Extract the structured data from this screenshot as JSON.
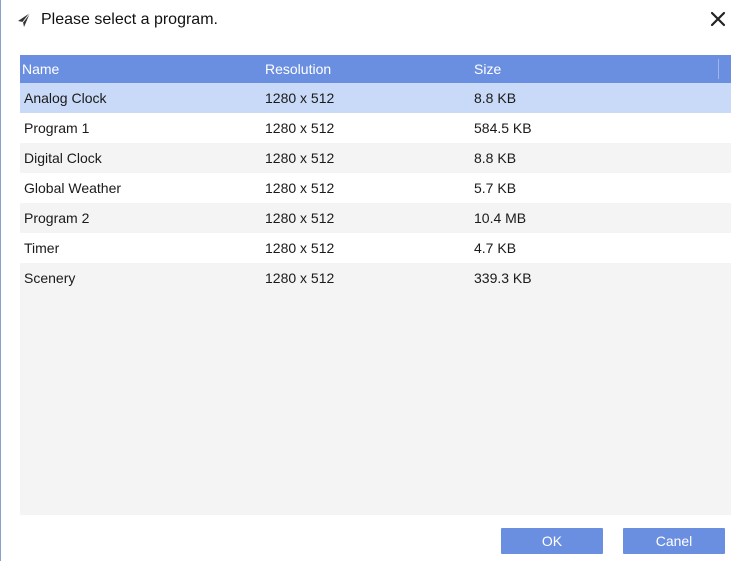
{
  "dialog": {
    "title": "Please select a program.",
    "title_icon": "send-arrow-icon",
    "close_icon": "close-icon"
  },
  "table": {
    "columns": {
      "name": "Name",
      "resolution": "Resolution",
      "size": "Size"
    },
    "selected_index": 0,
    "rows": [
      {
        "name": "Analog Clock",
        "resolution": "1280 x 512",
        "size": "8.8 KB"
      },
      {
        "name": "Program 1",
        "resolution": "1280 x 512",
        "size": "584.5 KB"
      },
      {
        "name": "Digital Clock",
        "resolution": "1280 x 512",
        "size": "8.8 KB"
      },
      {
        "name": "Global Weather",
        "resolution": "1280 x 512",
        "size": "5.7 KB"
      },
      {
        "name": "Program 2",
        "resolution": "1280 x 512",
        "size": "10.4 MB"
      },
      {
        "name": "Timer",
        "resolution": "1280 x 512",
        "size": "4.7 KB"
      },
      {
        "name": "Scenery",
        "resolution": "1280 x 512",
        "size": "339.3 KB"
      }
    ]
  },
  "buttons": {
    "ok_label": "OK",
    "cancel_label": "Canel"
  },
  "colors": {
    "accent": "#6b8fe0",
    "selected_row": "#c9daf8",
    "alt_row": "#f4f4f4"
  }
}
